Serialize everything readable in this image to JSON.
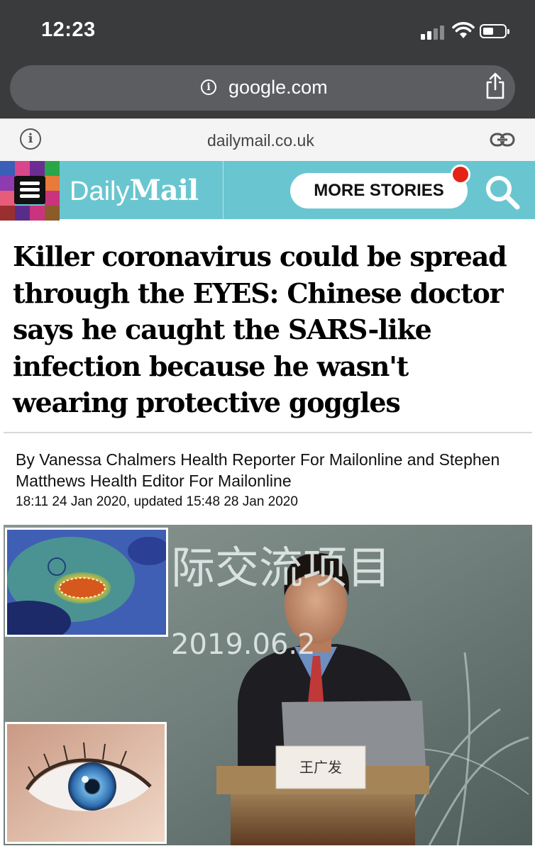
{
  "status_bar": {
    "time": "12:23"
  },
  "browser": {
    "url": "google.com",
    "site": "dailymail.co.uk"
  },
  "header": {
    "logo_daily": "Daily",
    "logo_mail": "Mail",
    "more_stories": "MORE STORIES",
    "accent_color": "#69c6d0"
  },
  "article": {
    "headline": "Killer coronavirus could be spread through the EYES: Chinese doctor says he caught the SARS-like infection because he wasn't wearing protective goggles",
    "byline": "By Vanessa Chalmers Health Reporter For Mailonline and Stephen Matthews Health Editor For Mailonline",
    "dateline": "18:11 24 Jan 2020, updated 15:48 28 Jan 2020"
  },
  "image": {
    "banner_text": "际交流项目",
    "date_text": "2019.06.2",
    "nameplate": "王广发"
  }
}
